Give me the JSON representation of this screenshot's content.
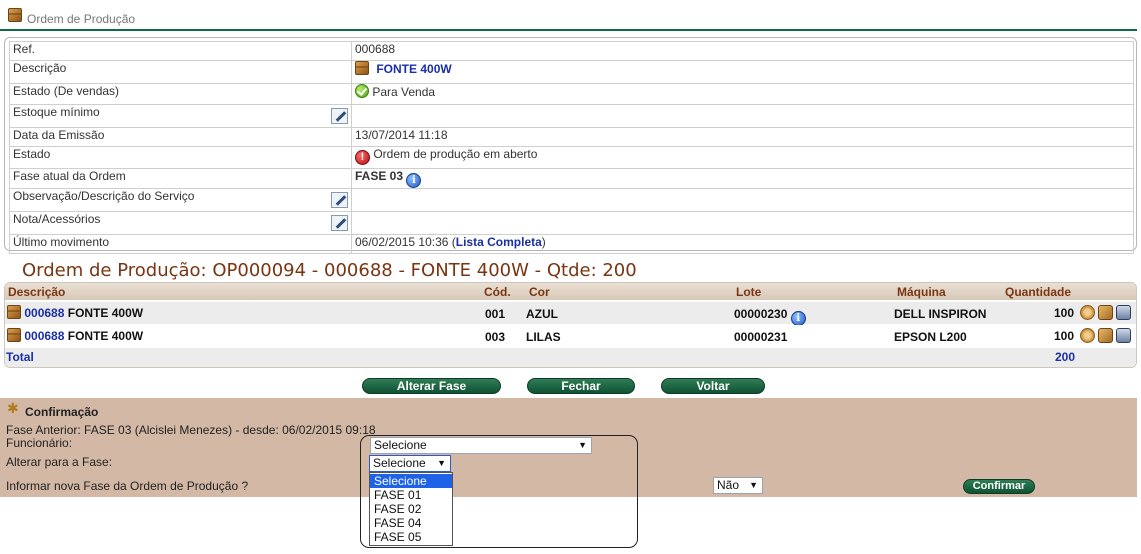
{
  "header": {
    "title": "Ordem de Produção"
  },
  "info": {
    "rows": [
      {
        "label": "Ref.",
        "value": "000688"
      },
      {
        "label": "Descrição",
        "value": "FONTE 400W"
      },
      {
        "label": "Estado (De vendas)",
        "value": "Para Venda"
      },
      {
        "label": "Estoque mínimo",
        "value": ""
      },
      {
        "label": "Data da Emissão",
        "value": "13/07/2014 11:18"
      },
      {
        "label": "Estado",
        "value": "Ordem de produção em aberto"
      },
      {
        "label": "Fase atual da Ordem",
        "value": "FASE 03"
      },
      {
        "label": "Observação/Descrição do Serviço",
        "value": ""
      },
      {
        "label": "Nota/Acessórios",
        "value": ""
      },
      {
        "label": "Último movimento",
        "value": "06/02/2015 10:36",
        "paren_open": " (",
        "link": "Lista Completa",
        "paren_close": ")"
      }
    ]
  },
  "op_title": "Ordem de Produção: OP000094 - 000688 - FONTE 400W - Qtde: 200",
  "items": {
    "headers": {
      "descricao": "Descrição",
      "cod": "Cód.",
      "cor": "Cor",
      "lote": "Lote",
      "maquina": "Máquina",
      "quantidade": "Quantidade"
    },
    "rows": [
      {
        "code": "000688",
        "desc": "FONTE 400W",
        "cod": "001",
        "cor": "AZUL",
        "lote": "00000230",
        "maquina": "DELL INSPIRON",
        "quantidade": "100"
      },
      {
        "code": "000688",
        "desc": "FONTE 400W",
        "cod": "003",
        "cor": "LILAS",
        "lote": "00000231",
        "maquina": "EPSON L200",
        "quantidade": "100"
      }
    ],
    "total_label": "Total",
    "total_value": "200"
  },
  "buttons": {
    "alterar_fase": "Alterar Fase",
    "fechar": "Fechar",
    "voltar": "Voltar"
  },
  "confirmacao": {
    "title": "Confirmação",
    "fase_anterior": "Fase Anterior: FASE 03 (Alcislei Menezes) - desde: 06/02/2015 09:18",
    "funcionario_label": "Funcionário:",
    "funcionario_value": "Selecione",
    "alterar_label": "Alterar para a Fase:",
    "alterar_value": "Selecione",
    "informar_label": "Informar nova Fase da Ordem de Produção ?",
    "informar_value": "Não",
    "confirm_button": "Confirmar",
    "fase_options": [
      "Selecione",
      "FASE 01",
      "FASE 02",
      "FASE 04",
      "FASE 05"
    ],
    "highlighted_option": "Selecione"
  },
  "colors": {
    "accent_green": "#0f5233",
    "title_brown": "#7a3512",
    "link_blue": "#1a2fa8",
    "panel_tan": "#d3b8a6",
    "highlight_blue": "#1e62e8"
  }
}
